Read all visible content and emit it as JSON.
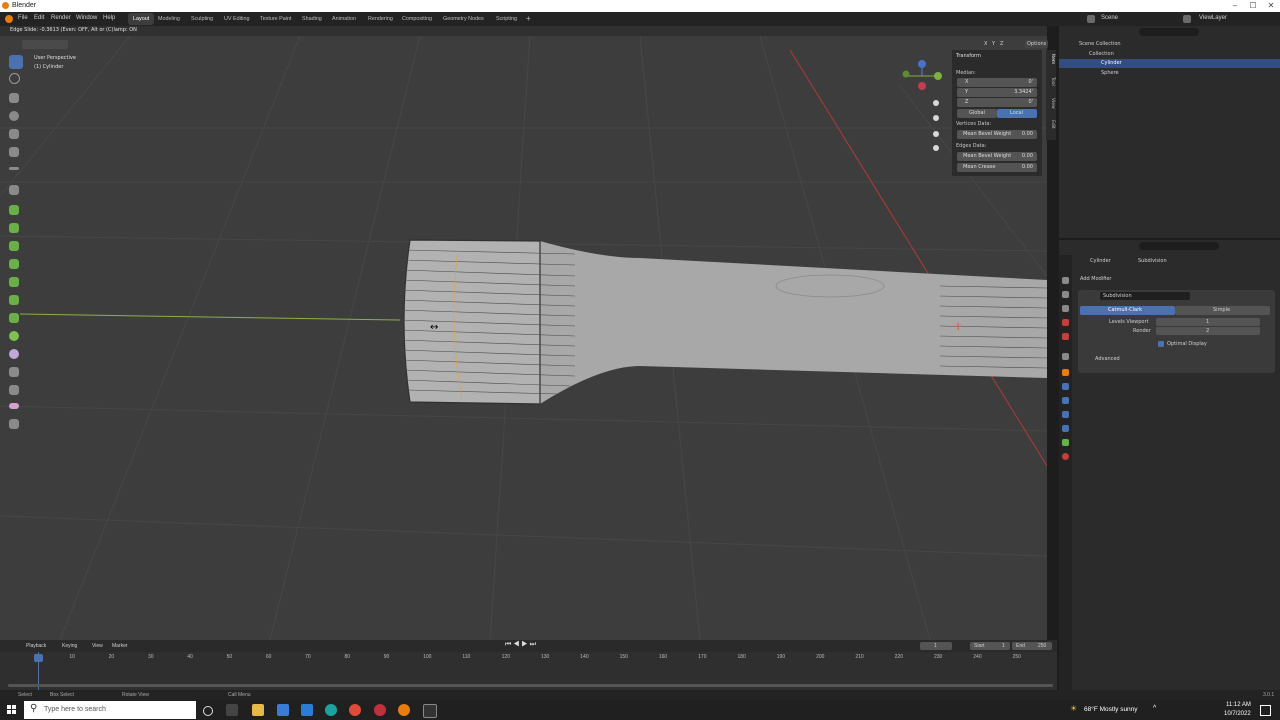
{
  "window": {
    "title": "Blender",
    "minimize": "–",
    "maximize": "☐",
    "close": "✕"
  },
  "menu": [
    "File",
    "Edit",
    "Render",
    "Window",
    "Help"
  ],
  "workspaces": [
    "Layout",
    "Modeling",
    "Sculpting",
    "UV Editing",
    "Texture Paint",
    "Shading",
    "Animation",
    "Rendering",
    "Compositing",
    "Geometry Nodes",
    "Scripting",
    "+"
  ],
  "scene": {
    "name": "Scene",
    "view_layer": "ViewLayer"
  },
  "operator_status": "Edge Slide: -0.3613 (Even: OFF, Alt or (C)lamp: ON",
  "viewport": {
    "perspective": "User Perspective",
    "object": "(1) Cylinder",
    "options": "Options",
    "axis_labels": [
      "X",
      "Y",
      "Z"
    ]
  },
  "npanel": {
    "tabs": [
      "Item",
      "Tool",
      "View",
      "Edit"
    ],
    "header": "Transform",
    "median_label": "Median:",
    "x_label": "X",
    "x_value": "0'",
    "y_label": "Y",
    "y_value": "3.3424'",
    "z_label": "Z",
    "z_value": "0'",
    "global": "Global",
    "local": "Local",
    "vertices_data": "Vertices Data:",
    "mean_bevel_weight_label": "Mean Bevel Weight",
    "mean_bevel_weight_v": "0.00",
    "edges_data": "Edges Data:",
    "mean_bevel_weight_e_label": "Mean Bevel Weight",
    "mean_bevel_weight_e": "0.00",
    "mean_crease_label": "Mean Crease",
    "mean_crease": "0.00"
  },
  "outliner": {
    "root": "Scene Collection",
    "collection": "Collection",
    "items": [
      "Cylinder",
      "Sphere"
    ]
  },
  "properties": {
    "breadcrumb_object": "Cylinder",
    "breadcrumb_modifier": "Subdivision",
    "add_modifier": "Add Modifier",
    "modifier_name": "Subdivision",
    "catmull_clark": "Catmull-Clark",
    "simple": "Simple",
    "levels_viewport_label": "Levels Viewport",
    "levels_viewport": "1",
    "render_label": "Render",
    "render": "2",
    "optimal_display": "Optimal Display",
    "advanced": "Advanced"
  },
  "timeline": {
    "menus": [
      "Playback",
      "Keying",
      "View",
      "Marker"
    ],
    "current_frame": "1",
    "start_label": "Start",
    "start": "1",
    "end_label": "End",
    "end": "250",
    "ruler": [
      "1",
      "10",
      "20",
      "30",
      "40",
      "50",
      "60",
      "70",
      "80",
      "90",
      "100",
      "110",
      "120",
      "130",
      "140",
      "150",
      "160",
      "170",
      "180",
      "190",
      "200",
      "210",
      "220",
      "230",
      "240",
      "250"
    ]
  },
  "statusbar": {
    "select": "Select",
    "box_select": "Box Select",
    "rotate_view": "Rotate View",
    "call_menu": "Call Menu",
    "version": "3.0.1"
  },
  "taskbar": {
    "search_placeholder": "Type here to search",
    "weather": "68°F  Mostly sunny",
    "time": "11:12 AM",
    "date": "10/7/2022"
  },
  "colors": {
    "accent": "#4a72b0",
    "viewport_bg": "#3d3d3d",
    "panel_bg": "#2b2b2b"
  }
}
